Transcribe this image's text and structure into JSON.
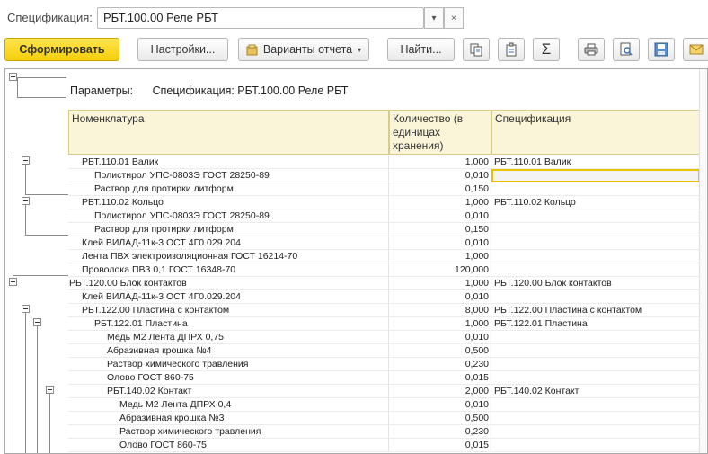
{
  "selector": {
    "label": "Спецификация:",
    "value": "РБТ.100.00 Реле РБТ",
    "dropdown_icon": "▾",
    "clear_icon": "×"
  },
  "toolbar": {
    "generate_label": "Сформировать",
    "settings_label": "Настройки...",
    "variants_label": "Варианты отчета",
    "variants_arrow": "▾",
    "find_label": "Найти...",
    "icons": [
      "copy-icon",
      "paste-icon",
      "sum-icon",
      "print-icon",
      "preview-icon",
      "save-icon",
      "email-icon"
    ],
    "sum_glyph": "Σ",
    "accent": "#f5cf0a"
  },
  "report": {
    "params_key": "Параметры:",
    "params_value": "Спецификация: РБТ.100.00 Реле РБТ",
    "columns": [
      "Номенклатура",
      "Количество (в единицах хранения)",
      "Спецификация"
    ],
    "rows": [
      {
        "name": "РБТ.110.01 Валик",
        "qty": "1,000",
        "spec": "РБТ.110.01 Валик",
        "level": 1
      },
      {
        "name": "Полистирол УПС-0803Э ГОСТ 28250-89",
        "qty": "0,010",
        "spec": "",
        "level": 2,
        "selected": true
      },
      {
        "name": "Раствор для протирки литформ",
        "qty": "0,150",
        "spec": "",
        "level": 2
      },
      {
        "name": "РБТ.110.02 Кольцо",
        "qty": "1,000",
        "spec": "РБТ.110.02 Кольцо",
        "level": 1
      },
      {
        "name": "Полистирол УПС-0803Э ГОСТ 28250-89",
        "qty": "0,010",
        "spec": "",
        "level": 2
      },
      {
        "name": "Раствор для протирки литформ",
        "qty": "0,150",
        "spec": "",
        "level": 2
      },
      {
        "name": "Клей ВИЛАД-11к-3 ОСТ 4Г0.029.204",
        "qty": "0,010",
        "spec": "",
        "level": 1
      },
      {
        "name": "Лента ПВХ электроизоляционная  ГОСТ 16214-70",
        "qty": "1,000",
        "spec": "",
        "level": 1
      },
      {
        "name": "Проволока ПВЗ 0,1 ГОСТ 16348-70",
        "qty": "120,000",
        "spec": "",
        "level": 1
      },
      {
        "name": "РБТ.120.00 Блок контактов",
        "qty": "1,000",
        "spec": "РБТ.120.00 Блок контактов",
        "level": 0
      },
      {
        "name": "Клей ВИЛАД-11к-3 ОСТ 4Г0.029.204",
        "qty": "0,010",
        "spec": "",
        "level": 1
      },
      {
        "name": "РБТ.122.00 Пластина с контактом",
        "qty": "8,000",
        "spec": "РБТ.122.00 Пластина с контактом",
        "level": 1
      },
      {
        "name": "РБТ.122.01 Пластина",
        "qty": "1,000",
        "spec": "РБТ.122.01 Пластина",
        "level": 2
      },
      {
        "name": "Медь М2 Лента ДПРХ  0,75",
        "qty": "0,010",
        "spec": "",
        "level": 3
      },
      {
        "name": "Абразивная крошка №4",
        "qty": "0,500",
        "spec": "",
        "level": 3
      },
      {
        "name": "Раствор химического травления",
        "qty": "0,230",
        "spec": "",
        "level": 3
      },
      {
        "name": "Олово ГОСТ 860-75",
        "qty": "0,015",
        "spec": "",
        "level": 3
      },
      {
        "name": "РБТ.140.02 Контакт",
        "qty": "2,000",
        "spec": "РБТ.140.02 Контакт",
        "level": 3
      },
      {
        "name": "Медь М2 Лента ДПРХ  0,4",
        "qty": "0,010",
        "spec": "",
        "level": 4
      },
      {
        "name": "Абразивная крошка №3",
        "qty": "0,500",
        "spec": "",
        "level": 4
      },
      {
        "name": "Раствор химического травления",
        "qty": "0,230",
        "spec": "",
        "level": 4
      },
      {
        "name": "Олово ГОСТ 860-75",
        "qty": "0,015",
        "spec": "",
        "level": 4
      }
    ]
  }
}
